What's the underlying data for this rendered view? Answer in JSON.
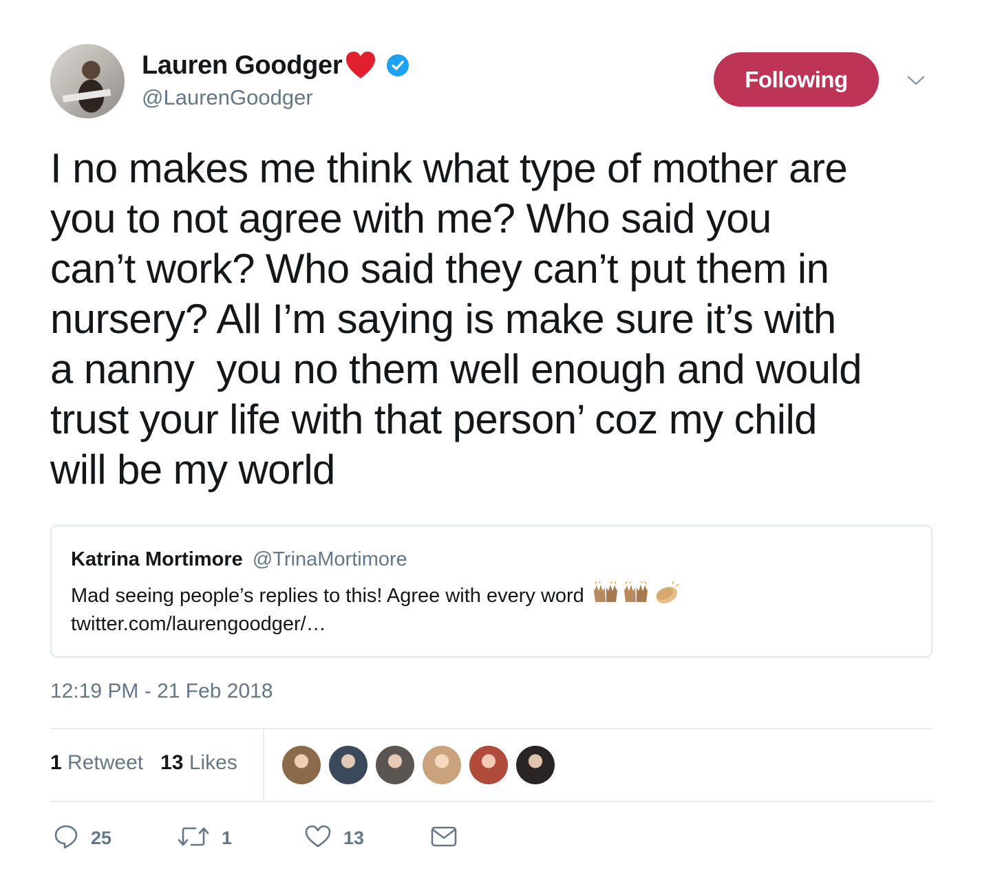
{
  "author": {
    "name": "Lauren Goodger",
    "handle": "@LaurenGoodger",
    "verified_icon": "verified-badge-icon",
    "name_emoji": "red-heart-icon"
  },
  "follow_button": {
    "label": "Following",
    "color": "#be3456"
  },
  "menu": {
    "icon": "chevron-down-icon"
  },
  "tweet": {
    "lines": [
      "I no makes me think what type of mother are",
      "you to not agree with me? Who said you",
      "can’t work? Who said they can’t put them in",
      "nursery? All I’m saying is make sure it’s with",
      "a nanny  you no them well enough and would",
      "trust your life with that person’ coz my child",
      "will be my world"
    ]
  },
  "quoted_tweet": {
    "name": "Katrina Mortimore",
    "handle": "@TrinaMortimore",
    "text": "Mad seeing people’s replies to this! Agree with every word",
    "emojis": [
      "raising-hands-icon",
      "raising-hands-icon",
      "clapping-hands-icon"
    ],
    "link": "twitter.com/laurengoodger/…"
  },
  "timestamp": "12:19 PM - 21 Feb 2018",
  "stats": {
    "retweets_count": "1",
    "retweets_label": "Retweet",
    "likes_count": "13",
    "likes_label": "Likes"
  },
  "likers": [
    {
      "color": "#8a6a4a"
    },
    {
      "color": "#3b4a5a"
    },
    {
      "color": "#5a5550"
    },
    {
      "color": "#c9a27e"
    },
    {
      "color": "#b04a3a"
    },
    {
      "color": "#2a2424"
    }
  ],
  "actions": {
    "reply": {
      "icon": "reply-icon",
      "count": "25"
    },
    "retweet": {
      "icon": "retweet-icon",
      "count": "1"
    },
    "like": {
      "icon": "heart-outline-icon",
      "count": "13"
    },
    "dm": {
      "icon": "envelope-icon"
    }
  },
  "colors": {
    "secondary_text": "#657786",
    "divider": "#e6ecf0",
    "verified": "#1da1f2"
  }
}
